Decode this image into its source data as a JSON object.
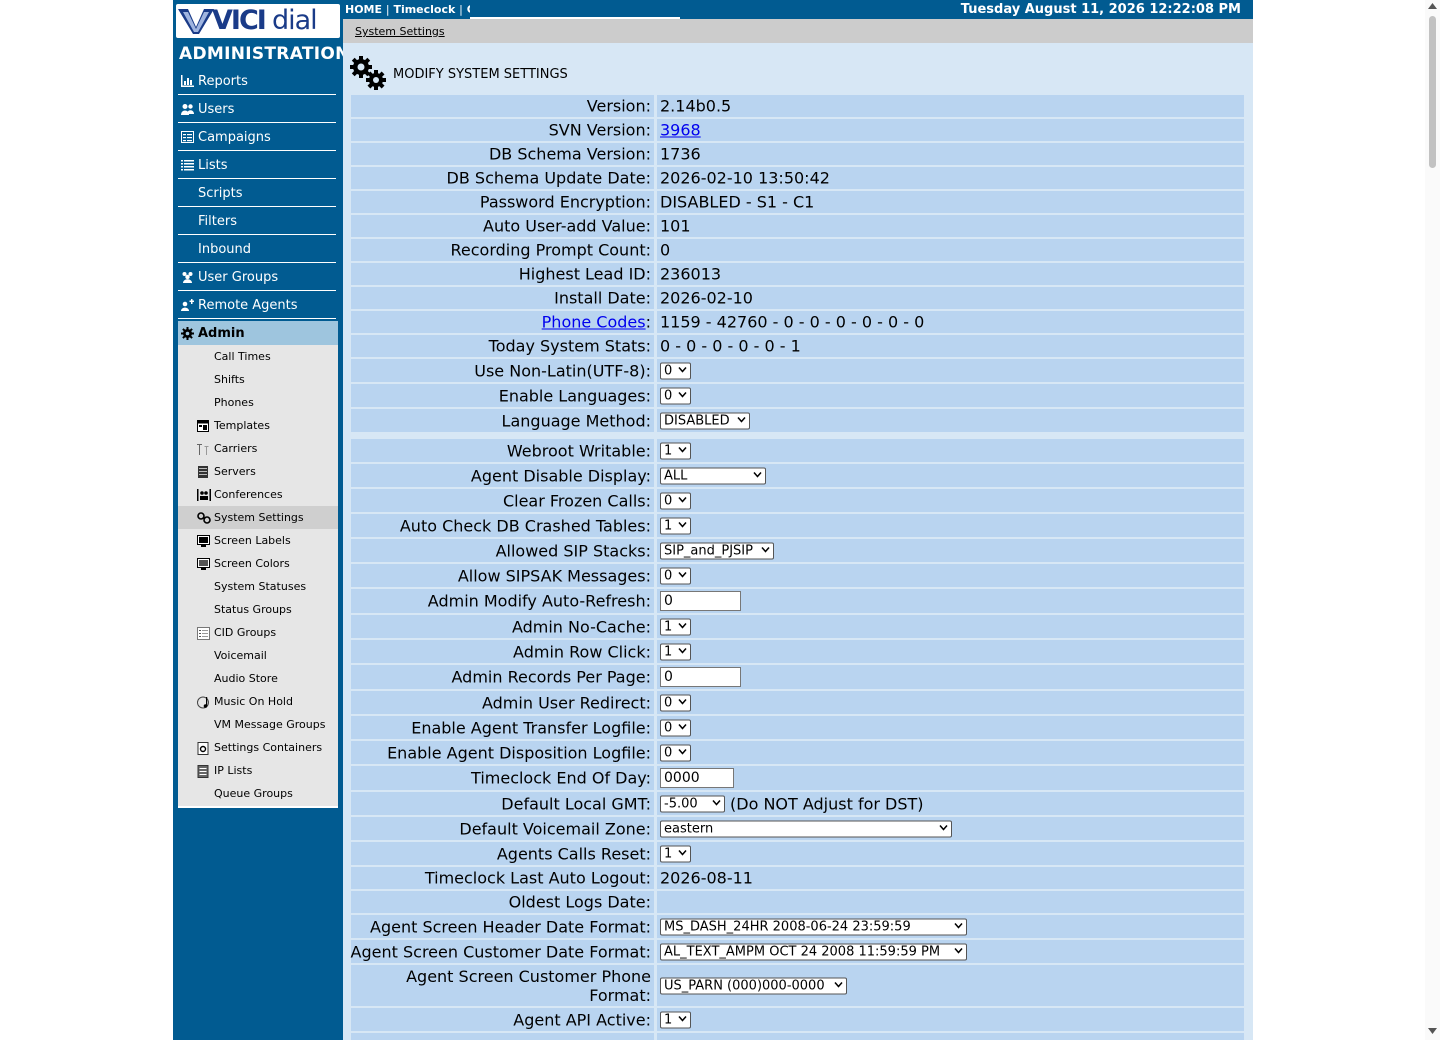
{
  "logo": {
    "vici": "VICI",
    "dial": "dial"
  },
  "sidebar": {
    "title": "ADMINISTRATION",
    "items": [
      {
        "label": "Reports",
        "icon": "reports-icon"
      },
      {
        "label": "Users",
        "icon": "users-icon"
      },
      {
        "label": "Campaigns",
        "icon": "campaigns-icon"
      },
      {
        "label": "Lists",
        "icon": "lists-icon"
      },
      {
        "label": "Scripts",
        "icon": ""
      },
      {
        "label": "Filters",
        "icon": ""
      },
      {
        "label": "Inbound",
        "icon": ""
      },
      {
        "label": "User Groups",
        "icon": "user-groups-icon"
      },
      {
        "label": "Remote Agents",
        "icon": "remote-agents-icon"
      }
    ],
    "admin_label": "Admin",
    "admin_items": [
      {
        "label": "Call Times"
      },
      {
        "label": "Shifts"
      },
      {
        "label": "Phones"
      },
      {
        "label": "Templates",
        "icon": "templates-icon"
      },
      {
        "label": "Carriers",
        "icon": "carriers-icon"
      },
      {
        "label": "Servers",
        "icon": "servers-icon"
      },
      {
        "label": "Conferences",
        "icon": "conferences-icon"
      },
      {
        "label": "System Settings",
        "icon": "system-settings-icon",
        "active": true
      },
      {
        "label": "Screen Labels",
        "icon": "screen-labels-icon"
      },
      {
        "label": "Screen Colors",
        "icon": "screen-colors-icon"
      },
      {
        "label": "System Statuses"
      },
      {
        "label": "Status Groups"
      },
      {
        "label": "CID Groups",
        "icon": "cid-groups-icon"
      },
      {
        "label": "Voicemail"
      },
      {
        "label": "Audio Store"
      },
      {
        "label": "Music On Hold",
        "icon": "music-on-hold-icon"
      },
      {
        "label": "VM Message Groups"
      },
      {
        "label": "Settings Containers",
        "icon": "settings-containers-icon"
      },
      {
        "label": "IP Lists",
        "icon": "ip-lists-icon"
      },
      {
        "label": "Queue Groups"
      }
    ]
  },
  "topbar": {
    "home": "HOME",
    "timeclock": "Timeclock",
    "chat": "Ch",
    "sep": "|",
    "datetime": "Tuesday August 11, 2026 12:22:08 PM"
  },
  "breadcrumb": "System Settings",
  "page_title": "MODIFY SYSTEM SETTINGS",
  "settings": {
    "version": {
      "label": "Version:",
      "value": "2.14b0.5"
    },
    "svn_version": {
      "label": "SVN Version:",
      "value": "3968"
    },
    "db_schema_version": {
      "label": "DB Schema Version:",
      "value": "1736"
    },
    "db_schema_update_date": {
      "label": "DB Schema Update Date:",
      "value": "2026-02-10 13:50:42"
    },
    "password_encryption": {
      "label": "Password Encryption:",
      "value": "DISABLED - S1 - C1"
    },
    "auto_user_add_value": {
      "label": "Auto User-add Value:",
      "value": "101"
    },
    "recording_prompt_count": {
      "label": "Recording Prompt Count:",
      "value": "0"
    },
    "highest_lead_id": {
      "label": "Highest Lead ID:",
      "value": "236013"
    },
    "install_date": {
      "label": "Install Date:",
      "value": "2026-02-10"
    },
    "phone_codes": {
      "label": "Phone Codes",
      "colon": ":",
      "value": "1159 - 42760 - 0 - 0 - 0 - 0 - 0 - 0"
    },
    "today_system_stats": {
      "label": "Today System Stats:",
      "value": "0 - 0 - 0 - 0 - 0 - 1"
    },
    "use_non_latin": {
      "label": "Use Non-Latin(UTF-8):",
      "value": "0"
    },
    "enable_languages": {
      "label": "Enable Languages:",
      "value": "0"
    },
    "language_method": {
      "label": "Language Method:",
      "value": "DISABLED"
    },
    "webroot_writable": {
      "label": "Webroot Writable:",
      "value": "1"
    },
    "agent_disable_display": {
      "label": "Agent Disable Display:",
      "value": "ALL"
    },
    "clear_frozen_calls": {
      "label": "Clear Frozen Calls:",
      "value": "0"
    },
    "auto_check_db_crashed_tables": {
      "label": "Auto Check DB Crashed Tables:",
      "value": "1"
    },
    "allowed_sip_stacks": {
      "label": "Allowed SIP Stacks:",
      "value": "SIP_and_PJSIP"
    },
    "allow_sipsak_messages": {
      "label": "Allow SIPSAK Messages:",
      "value": "0"
    },
    "admin_modify_auto_refresh": {
      "label": "Admin Modify Auto-Refresh:",
      "value": "0"
    },
    "admin_no_cache": {
      "label": "Admin No-Cache:",
      "value": "1"
    },
    "admin_row_click": {
      "label": "Admin Row Click:",
      "value": "1"
    },
    "admin_records_per_page": {
      "label": "Admin Records Per Page:",
      "value": "0"
    },
    "admin_user_redirect": {
      "label": "Admin User Redirect:",
      "value": "0"
    },
    "enable_agent_transfer_logfile": {
      "label": "Enable Agent Transfer Logfile:",
      "value": "0"
    },
    "enable_agent_disposition_logfile": {
      "label": "Enable Agent Disposition Logfile:",
      "value": "0"
    },
    "timeclock_end_of_day": {
      "label": "Timeclock End Of Day:",
      "value": "0000"
    },
    "default_local_gmt": {
      "label": "Default Local GMT:",
      "value": "-5.00",
      "note": "(Do NOT Adjust for DST)"
    },
    "default_voicemail_zone": {
      "label": "Default Voicemail Zone:",
      "value": "eastern"
    },
    "agents_calls_reset": {
      "label": "Agents Calls Reset:",
      "value": "1"
    },
    "timeclock_last_auto_logout": {
      "label": "Timeclock Last Auto Logout:",
      "value": "2026-08-11"
    },
    "oldest_logs_date": {
      "label": "Oldest Logs Date:",
      "value": ""
    },
    "agent_screen_header_date_format": {
      "label": "Agent Screen Header Date Format:",
      "value": "MS_DASH_24HR 2008-06-24 23:59:59"
    },
    "agent_screen_customer_date_format": {
      "label": "Agent Screen Customer Date Format:",
      "value": "AL_TEXT_AMPM OCT 24 2008 11:59:59 PM"
    },
    "agent_screen_customer_phone_format": {
      "label": "Agent Screen Customer Phone Format:",
      "value": "US_PARN (000)000-0000"
    },
    "agent_api_active": {
      "label": "Agent API Active:",
      "value": "1"
    }
  },
  "colors": {
    "sidebar_bg": "#015b91",
    "main_bg": "#d7e7f5",
    "row_bg": "#b9d4f0",
    "crumb_bg": "#cccccc",
    "admin_header_bg": "#9ec5de",
    "link": "#0000ee"
  }
}
